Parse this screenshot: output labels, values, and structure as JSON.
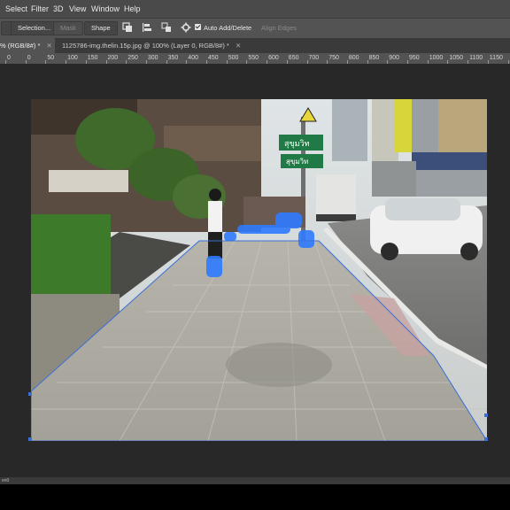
{
  "menu": [
    "Select",
    "Filter",
    "3D",
    "View",
    "Window",
    "Help"
  ],
  "options": {
    "selection_label": "Selection...",
    "mask_label": "Mask",
    "shape_label": "Shape",
    "auto_add_delete_label": "Auto Add/Delete",
    "align_edges_label": "Align Edges",
    "auto_add_delete_checked": true
  },
  "tabs": [
    {
      "label": "% (RGB/8#) *",
      "active": true
    },
    {
      "label": "1125786-img.thelin.15p.jpg @ 100% (Layer 0, RGB/8#) *",
      "active": false
    }
  ],
  "ruler": [
    "0",
    "0",
    "50",
    "100",
    "150",
    "200",
    "250",
    "300",
    "350",
    "400",
    "450",
    "500",
    "550",
    "600",
    "650",
    "700",
    "750",
    "800",
    "850",
    "900",
    "950",
    "1000",
    "1050",
    "1100",
    "1150",
    "120"
  ],
  "signs": {
    "sign1_text": "สุขุมวิท",
    "sign2_text": "สุขุมวิท"
  },
  "status": {
    "text": "en0"
  },
  "colors": {
    "menubar": "#4a4a4a",
    "optionsbar": "#535353",
    "canvas": "#282828",
    "path_selection": "#3b6fd6",
    "brush_overlay": "#2f7bff"
  }
}
